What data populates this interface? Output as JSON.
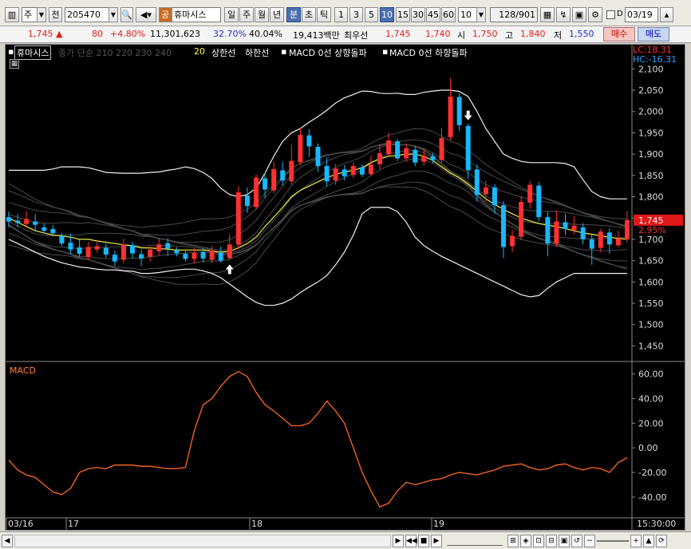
{
  "toolbar": {
    "period": "주",
    "ref": "전",
    "code": "205470",
    "name": "휴마시스",
    "periods": [
      "일",
      "주",
      "월",
      "년",
      "분",
      "초",
      "틱"
    ],
    "minutes": [
      "1",
      "3",
      "5",
      "10",
      "15",
      "30",
      "45",
      "60"
    ],
    "count": "10",
    "range": "128/901",
    "d_label": "D",
    "date": "03/19",
    "tag_label": "공"
  },
  "quote": {
    "price": "1,745",
    "change": "80",
    "change_pct": "+4.80%",
    "volume": "11,301,623",
    "turnover": "32.70%",
    "rate2": "40.04%",
    "amount": "19,413백만",
    "best_label": "최우선",
    "ask": "1,745",
    "bid": "1,740",
    "open_label": "시",
    "open": "1,750",
    "high_label": "고",
    "high": "1,840",
    "low_label": "저",
    "low": "1,550",
    "buy_label": "매수",
    "sell_label": "매도"
  },
  "legend": {
    "name": "휴마시스",
    "ma_text": "종가 단순 210 220 230 240",
    "ma20": "20",
    "upper": "상한선",
    "lower": "하한선",
    "macd_up": "MACD 0선 상향돌파",
    "macd_down": "MACD 0선 하향돌파",
    "lc": "LC:18.31",
    "hc": "HC:-16.31",
    "price_tag": "1,745",
    "pct_tag": "2.95%",
    "macd_label": "MACD"
  },
  "time_axis": {
    "labels": [
      "03/16",
      "17",
      "18",
      "19"
    ],
    "end": "15:30:00"
  },
  "chart_data": [
    {
      "type": "candlestick",
      "title": "휴마시스",
      "yticks": [
        2100,
        2050,
        2000,
        1950,
        1900,
        1850,
        1800,
        1750,
        1700,
        1650,
        1600,
        1550,
        1500,
        1450
      ],
      "ylim": [
        1417,
        2110
      ],
      "last_price": 1745,
      "bb_upper": [
        1862,
        1862,
        1862,
        1862,
        1862,
        1865,
        1870,
        1870,
        1870,
        1868,
        1863,
        1857,
        1856,
        1855,
        1855,
        1855,
        1857,
        1858,
        1862,
        1865,
        1870,
        1866,
        1857,
        1843,
        1820,
        1805,
        1800,
        1805,
        1820,
        1855,
        1895,
        1930,
        1950,
        1960,
        1975,
        1988,
        2003,
        2020,
        2032,
        2040,
        2048,
        2047,
        2043,
        2042,
        2043,
        2040,
        2040,
        2045,
        2048,
        2050,
        2050,
        2047,
        2035,
        2000,
        1960,
        1930,
        1900,
        1890,
        1883,
        1880,
        1880,
        1880,
        1880,
        1878,
        1870,
        1840,
        1812,
        1800,
        1795,
        1795,
        1795
      ],
      "bb_lower": [
        1700,
        1690,
        1680,
        1670,
        1660,
        1652,
        1645,
        1640,
        1635,
        1633,
        1630,
        1628,
        1628,
        1626,
        1625,
        1620,
        1620,
        1622,
        1625,
        1628,
        1630,
        1630,
        1626,
        1620,
        1610,
        1595,
        1580,
        1565,
        1552,
        1545,
        1545,
        1550,
        1560,
        1575,
        1588,
        1600,
        1615,
        1640,
        1670,
        1710,
        1760,
        1775,
        1775,
        1775,
        1765,
        1740,
        1705,
        1685,
        1672,
        1660,
        1650,
        1640,
        1630,
        1620,
        1610,
        1600,
        1590,
        1580,
        1570,
        1565,
        1568,
        1585,
        1600,
        1610,
        1620,
        1620,
        1620,
        1620,
        1620,
        1620,
        1620
      ],
      "ma20": [
        1750,
        1740,
        1730,
        1720,
        1715,
        1710,
        1708,
        1705,
        1700,
        1700,
        1696,
        1693,
        1690,
        1687,
        1685,
        1680,
        1680,
        1678,
        1677,
        1675,
        1675,
        1675,
        1675,
        1672,
        1670,
        1672,
        1680,
        1690,
        1705,
        1730,
        1752,
        1775,
        1800,
        1815,
        1825,
        1835,
        1845,
        1852,
        1858,
        1862,
        1868,
        1880,
        1889,
        1895,
        1897,
        1900,
        1900,
        1895,
        1885,
        1870,
        1855,
        1845,
        1830,
        1812,
        1795,
        1782,
        1770,
        1760,
        1750,
        1743,
        1737,
        1733,
        1730,
        1725,
        1720,
        1715,
        1712,
        1708,
        1705,
        1702,
        1700
      ],
      "candles": [
        [
          1752,
          1742,
          1765,
          1728
        ],
        [
          1744,
          1738,
          1760,
          1728
        ],
        [
          1736,
          1748,
          1766,
          1728
        ],
        [
          1742,
          1734,
          1759,
          1719
        ],
        [
          1728,
          1720,
          1737,
          1714
        ],
        [
          1724,
          1714,
          1733,
          1709
        ],
        [
          1708,
          1690,
          1715,
          1684
        ],
        [
          1692,
          1676,
          1713,
          1665
        ],
        [
          1681,
          1666,
          1699,
          1659
        ],
        [
          1658,
          1682,
          1694,
          1651
        ],
        [
          1676,
          1684,
          1699,
          1669
        ],
        [
          1680,
          1664,
          1690,
          1656
        ],
        [
          1664,
          1648,
          1674,
          1638
        ],
        [
          1652,
          1688,
          1702,
          1644
        ],
        [
          1686,
          1667,
          1694,
          1656
        ],
        [
          1665,
          1655,
          1676,
          1637
        ],
        [
          1659,
          1676,
          1684,
          1648
        ],
        [
          1672,
          1688,
          1702,
          1662
        ],
        [
          1691,
          1678,
          1703,
          1661
        ],
        [
          1674,
          1667,
          1682,
          1660
        ],
        [
          1666,
          1654,
          1676,
          1648
        ],
        [
          1654,
          1668,
          1679,
          1643
        ],
        [
          1670,
          1655,
          1679,
          1646
        ],
        [
          1652,
          1674,
          1684,
          1644
        ],
        [
          1668,
          1650,
          1683,
          1645
        ],
        [
          1656,
          1688,
          1712,
          1652
        ],
        [
          1688,
          1810,
          1825,
          1677
        ],
        [
          1803,
          1778,
          1822,
          1762
        ],
        [
          1776,
          1845,
          1852,
          1770
        ],
        [
          1843,
          1817,
          1856,
          1798
        ],
        [
          1815,
          1865,
          1882,
          1808
        ],
        [
          1862,
          1838,
          1882,
          1826
        ],
        [
          1836,
          1884,
          1922,
          1828
        ],
        [
          1881,
          1945,
          1962,
          1874
        ],
        [
          1944,
          1918,
          1958,
          1894
        ],
        [
          1917,
          1872,
          1925,
          1858
        ],
        [
          1872,
          1836,
          1892,
          1824
        ],
        [
          1838,
          1866,
          1877,
          1828
        ],
        [
          1864,
          1848,
          1874,
          1838
        ],
        [
          1851,
          1872,
          1880,
          1844
        ],
        [
          1869,
          1852,
          1876,
          1846
        ],
        [
          1853,
          1875,
          1896,
          1849
        ],
        [
          1876,
          1902,
          1922,
          1864
        ],
        [
          1900,
          1932,
          1950,
          1895
        ],
        [
          1930,
          1890,
          1936,
          1884
        ],
        [
          1890,
          1914,
          1925,
          1882
        ],
        [
          1910,
          1880,
          1918,
          1872
        ],
        [
          1882,
          1896,
          1912,
          1874
        ],
        [
          1895,
          1886,
          1903,
          1878
        ],
        [
          1886,
          1938,
          1961,
          1880
        ],
        [
          1940,
          2035,
          2078,
          1932
        ],
        [
          2034,
          1968,
          2042,
          1954
        ],
        [
          1966,
          1862,
          1972,
          1842
        ],
        [
          1864,
          1804,
          1876,
          1788
        ],
        [
          1806,
          1822,
          1838,
          1790
        ],
        [
          1822,
          1780,
          1830,
          1760
        ],
        [
          1780,
          1682,
          1790,
          1656
        ],
        [
          1684,
          1708,
          1722,
          1670
        ],
        [
          1706,
          1788,
          1802,
          1698
        ],
        [
          1786,
          1828,
          1836,
          1772
        ],
        [
          1826,
          1752,
          1834,
          1742
        ],
        [
          1752,
          1690,
          1766,
          1660
        ],
        [
          1690,
          1742,
          1768,
          1682
        ],
        [
          1740,
          1724,
          1760,
          1710
        ],
        [
          1722,
          1732,
          1754,
          1712
        ],
        [
          1728,
          1700,
          1738,
          1688
        ],
        [
          1700,
          1678,
          1712,
          1640
        ],
        [
          1680,
          1718,
          1724,
          1670
        ],
        [
          1716,
          1688,
          1726,
          1666
        ],
        [
          1686,
          1702,
          1720,
          1682
        ],
        [
          1700,
          1745,
          1766,
          1692
        ]
      ],
      "markers": [
        {
          "type": "up",
          "index": 25
        },
        {
          "type": "down",
          "index": 52
        }
      ]
    },
    {
      "type": "line",
      "title": "MACD",
      "yticks": [
        60,
        40,
        20,
        0,
        -20,
        -40
      ],
      "ylim": [
        -55,
        65
      ],
      "values": [
        -10,
        -18,
        -22,
        -24,
        -30,
        -36,
        -38,
        -33,
        -20,
        -17,
        -16,
        -17,
        -14,
        -14,
        -14,
        -15,
        -15,
        -16,
        -17,
        -17,
        -16,
        14,
        35,
        40,
        50,
        58,
        62,
        58,
        45,
        35,
        30,
        24,
        18,
        18,
        20,
        28,
        38,
        30,
        20,
        0,
        -20,
        -35,
        -48,
        -45,
        -35,
        -28,
        -30,
        -28,
        -26,
        -25,
        -22,
        -20,
        -21,
        -22,
        -20,
        -18,
        -15,
        -14,
        -13,
        -16,
        -18,
        -17,
        -14,
        -13,
        -16,
        -18,
        -16,
        -17,
        -20,
        -12,
        -8
      ]
    }
  ]
}
